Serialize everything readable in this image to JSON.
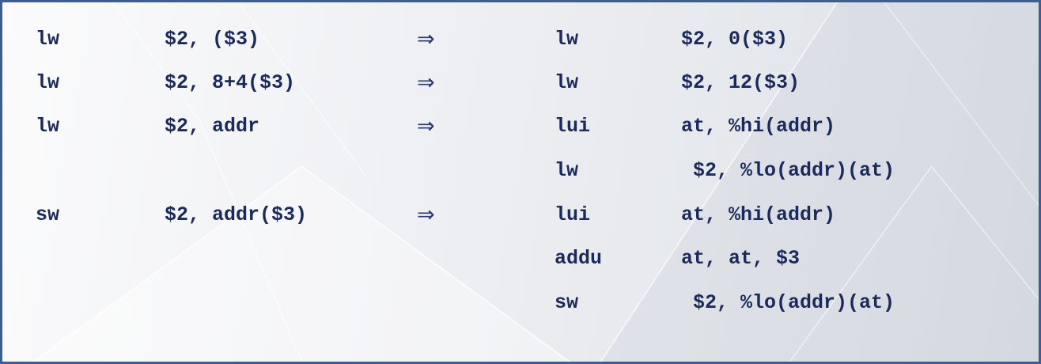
{
  "rows": [
    {
      "op": "lw",
      "args": "$2, ($3)",
      "arrow": "⇒",
      "rop": "lw",
      "rargs": "$2, 0($3)"
    },
    {
      "op": "lw",
      "args": "$2, 8+4($3)",
      "arrow": "⇒",
      "rop": "lw",
      "rargs": "$2, 12($3)"
    },
    {
      "op": "lw",
      "args": "$2, addr",
      "arrow": "⇒",
      "rop": "lui",
      "rargs": "at, %hi(addr)"
    },
    {
      "op": "",
      "args": "",
      "arrow": "",
      "rop": "lw",
      "rargs": " $2, %lo(addr)(at)"
    },
    {
      "op": "sw",
      "args": "$2, addr($3)",
      "arrow": "⇒",
      "rop": "lui",
      "rargs": "at, %hi(addr)"
    },
    {
      "op": "",
      "args": "",
      "arrow": "",
      "rop": "addu",
      "rargs": "at, at, $3"
    },
    {
      "op": "",
      "args": "",
      "arrow": "",
      "rop": "sw",
      "rargs": " $2, %lo(addr)(at)"
    }
  ],
  "colors": {
    "border": "#3f5c93",
    "text": "#1b2a5a"
  }
}
